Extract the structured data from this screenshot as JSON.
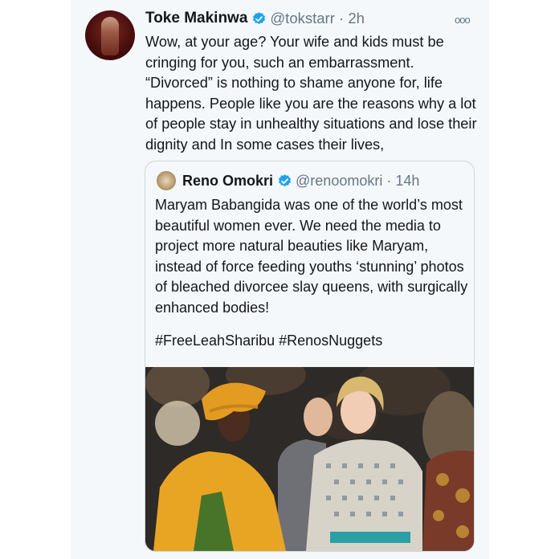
{
  "tweet": {
    "author_name": "Toke Makinwa",
    "author_handle": "@tokstarr",
    "time": "2h",
    "more_icon": "more-icon",
    "text": "Wow, at your age? Your wife and kids must be cringing for you, such an embarrassment. “Divorced” is nothing to shame anyone for, life happens. People like you are the reasons why  a lot of people stay in unhealthy situations and lose their dignity and In some cases their lives,"
  },
  "quote": {
    "author_name": "Reno Omokri",
    "author_handle": "@renoomokri",
    "time": "14h",
    "text": "Maryam Babangida was one of the world’s most beautiful women ever. We need the media to project more natural beauties like Maryam, instead of force feeding youths ‘stunning’ photos of bleached divorcee slay queens, with surgically enhanced bodies!",
    "hashtags": "#FreeLeahSharibu #RenosNuggets"
  },
  "colors": {
    "verified": "#1da1f2",
    "text": "#14171a",
    "secondary": "#657786",
    "background": "#f5f8fa",
    "border": "#ccd6dd"
  }
}
